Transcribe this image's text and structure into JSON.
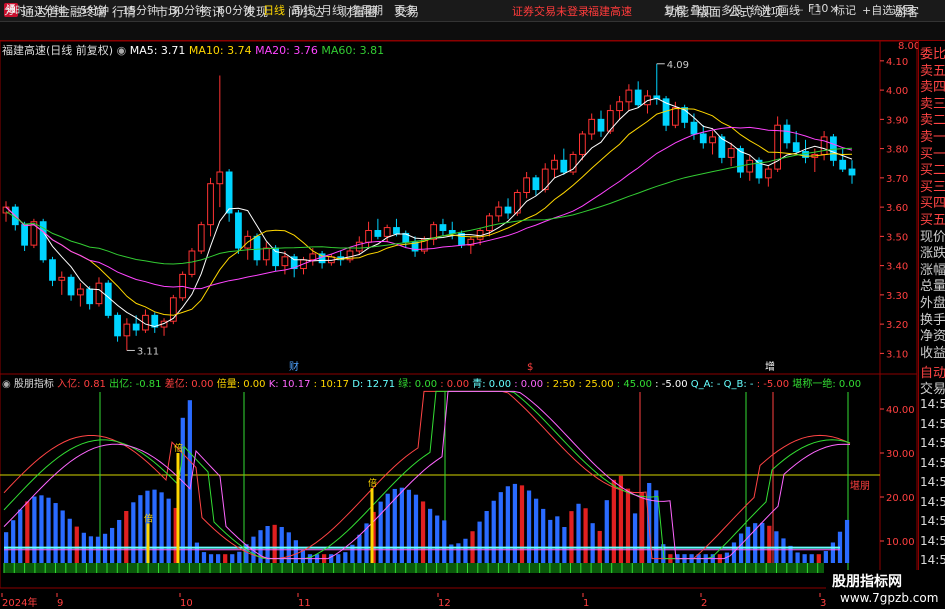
{
  "app": {
    "title": "通达信金融终端",
    "logo": "通"
  },
  "menu": [
    "行情",
    "市场",
    "资讯",
    "发现",
    "问小达",
    "财富圈",
    "交易"
  ],
  "alerts": {
    "login": "证券交易未登录",
    "stock": "福建高速"
  },
  "right_menu": [
    "功能",
    "版面",
    "公式",
    "选项"
  ],
  "guest": "游客",
  "window_buttons": [
    "minimize-icon",
    "restore-icon",
    "close-icon"
  ],
  "periods": [
    "分时",
    "1分钟",
    "5分钟",
    "15分钟",
    "30分钟",
    "60分钟",
    "日线",
    "周线",
    "月线",
    "多周期",
    "更多"
  ],
  "active_period": "日线",
  "toolbar_right": [
    "复权",
    "叠加",
    "多股",
    "统计",
    "画线",
    "F10",
    "标记",
    "+自选",
    "返回"
  ],
  "chart_info": {
    "stock": "福建高速",
    "adjust": "(日线 前复权)",
    "ma5": "MA5: 3.71",
    "ma10": "MA10: 3.74",
    "ma20": "MA20: 3.76",
    "ma60": "MA60: 3.81",
    "high_marker": "4.09",
    "low_marker": "3.11",
    "events": [
      "财",
      "$",
      "增"
    ]
  },
  "price_axis": [
    "4.10",
    "4.00",
    "3.90",
    "3.80",
    "3.70",
    "3.60",
    "3.50",
    "3.40",
    "3.30",
    "3.20",
    "3.10"
  ],
  "price_corner": "8.00",
  "indicator": {
    "name": "股朋指标",
    "items": [
      {
        "label": "入亿: 0.81",
        "color": "#ff4040"
      },
      {
        "label": "出亿: -0.81",
        "color": "#33dd33"
      },
      {
        "label": "差亿: 0.00",
        "color": "#ff4040"
      },
      {
        "label": "倍量: 0.00",
        "color": "#ffd700"
      },
      {
        "label": "K: 10.17",
        "color": "#ff66ff"
      },
      {
        "label": ": 10:17",
        "color": "#ffd700"
      },
      {
        "label": "D: 12.71",
        "color": "#66ffff"
      },
      {
        "label": "绿: 0.00",
        "color": "#33dd33"
      },
      {
        "label": ": 0.00",
        "color": "#ff4040"
      },
      {
        "label": "青: 0.00",
        "color": "#66ffff"
      },
      {
        "label": ": 0.00",
        "color": "#ff66ff"
      },
      {
        "label": ": 2:50",
        "color": "#ffd700"
      },
      {
        "label": ": 25.00",
        "color": "#ffd700"
      },
      {
        "label": ": 45.00",
        "color": "#33dd33"
      },
      {
        "label": ": -5.00",
        "color": "#ffffff"
      },
      {
        "label": "Q_A: -",
        "color": "#66ffff"
      },
      {
        "label": "Q_B: -",
        "color": "#66ffff"
      },
      {
        "label": ": -5.00",
        "color": "#ff4040"
      },
      {
        "label": "堪称一绝: 0.00",
        "color": "#33dd33"
      }
    ],
    "axis": [
      "40.00",
      "30.00",
      "20.00",
      "10.00"
    ],
    "label_in_chart": "堪朋",
    "bei_marks": [
      "倍",
      "倍",
      "倍"
    ]
  },
  "date_axis": [
    "2024年",
    "9",
    "10",
    "11",
    "12",
    "1",
    "2",
    "3"
  ],
  "right_panel": {
    "labels": [
      {
        "t": "委比",
        "c": "red"
      },
      {
        "t": "卖五",
        "c": "red"
      },
      {
        "t": "卖四",
        "c": "red"
      },
      {
        "t": "卖三",
        "c": "red"
      },
      {
        "t": "卖二",
        "c": "red"
      },
      {
        "t": "卖一",
        "c": "red"
      },
      {
        "t": "买一",
        "c": "red"
      },
      {
        "t": "买二",
        "c": "red"
      },
      {
        "t": "买三",
        "c": "red"
      },
      {
        "t": "买四",
        "c": "red"
      },
      {
        "t": "买五",
        "c": "red"
      },
      {
        "t": "现价",
        "c": ""
      },
      {
        "t": "涨跌",
        "c": ""
      },
      {
        "t": "涨幅",
        "c": ""
      },
      {
        "t": "总量",
        "c": ""
      },
      {
        "t": "外盘",
        "c": ""
      },
      {
        "t": "换手",
        "c": ""
      },
      {
        "t": "净资",
        "c": ""
      },
      {
        "t": "收益",
        "c": ""
      },
      {
        "t": "自动",
        "c": "red"
      },
      {
        "t": "交易",
        "c": ""
      }
    ],
    "times": [
      "14:56",
      "14:56",
      "14:56",
      "14:56",
      "14:56",
      "14:56",
      "14:56",
      "14:56",
      "14:56"
    ]
  },
  "watermark": {
    "line1": "股朋指标网",
    "line2": "www.7gpzb.com"
  },
  "colors": {
    "up": "#ff3333",
    "down": "#00d4ff",
    "ma5": "#ffffff",
    "ma10": "#ffd700",
    "ma20": "#ff44ff",
    "ma60": "#33cc33",
    "grid": "#8b0000"
  },
  "chart_data": {
    "type": "candlestick",
    "series_note": "daily OHLC approximated from chart",
    "candles": [
      [
        3.58,
        3.62,
        3.55,
        3.6
      ],
      [
        3.6,
        3.61,
        3.52,
        3.54
      ],
      [
        3.54,
        3.55,
        3.45,
        3.47
      ],
      [
        3.47,
        3.56,
        3.46,
        3.55
      ],
      [
        3.55,
        3.56,
        3.41,
        3.42
      ],
      [
        3.42,
        3.43,
        3.33,
        3.35
      ],
      [
        3.35,
        3.38,
        3.3,
        3.36
      ],
      [
        3.36,
        3.37,
        3.28,
        3.3
      ],
      [
        3.3,
        3.34,
        3.26,
        3.32
      ],
      [
        3.32,
        3.33,
        3.25,
        3.27
      ],
      [
        3.27,
        3.36,
        3.26,
        3.34
      ],
      [
        3.34,
        3.35,
        3.22,
        3.23
      ],
      [
        3.23,
        3.24,
        3.14,
        3.16
      ],
      [
        3.16,
        3.22,
        3.11,
        3.2
      ],
      [
        3.2,
        3.23,
        3.16,
        3.18
      ],
      [
        3.18,
        3.25,
        3.17,
        3.23
      ],
      [
        3.23,
        3.24,
        3.17,
        3.19
      ],
      [
        3.19,
        3.22,
        3.16,
        3.21
      ],
      [
        3.21,
        3.3,
        3.2,
        3.29
      ],
      [
        3.29,
        3.38,
        3.28,
        3.37
      ],
      [
        3.37,
        3.46,
        3.36,
        3.45
      ],
      [
        3.45,
        3.55,
        3.44,
        3.54
      ],
      [
        3.54,
        3.7,
        3.5,
        3.68
      ],
      [
        3.68,
        4.05,
        3.6,
        3.72
      ],
      [
        3.72,
        3.73,
        3.55,
        3.58
      ],
      [
        3.58,
        3.59,
        3.44,
        3.46
      ],
      [
        3.46,
        3.52,
        3.42,
        3.5
      ],
      [
        3.5,
        3.51,
        3.4,
        3.42
      ],
      [
        3.42,
        3.48,
        3.4,
        3.46
      ],
      [
        3.46,
        3.47,
        3.38,
        3.4
      ],
      [
        3.4,
        3.45,
        3.37,
        3.43
      ],
      [
        3.43,
        3.44,
        3.36,
        3.39
      ],
      [
        3.39,
        3.43,
        3.37,
        3.42
      ],
      [
        3.42,
        3.46,
        3.4,
        3.44
      ],
      [
        3.44,
        3.45,
        3.39,
        3.41
      ],
      [
        3.41,
        3.44,
        3.4,
        3.43
      ],
      [
        3.43,
        3.45,
        3.4,
        3.42
      ],
      [
        3.42,
        3.46,
        3.41,
        3.45
      ],
      [
        3.45,
        3.5,
        3.44,
        3.48
      ],
      [
        3.48,
        3.55,
        3.46,
        3.52
      ],
      [
        3.52,
        3.56,
        3.49,
        3.5
      ],
      [
        3.5,
        3.54,
        3.48,
        3.53
      ],
      [
        3.53,
        3.56,
        3.5,
        3.51
      ],
      [
        3.51,
        3.52,
        3.46,
        3.48
      ],
      [
        3.48,
        3.5,
        3.43,
        3.45
      ],
      [
        3.45,
        3.5,
        3.44,
        3.49
      ],
      [
        3.49,
        3.55,
        3.47,
        3.54
      ],
      [
        3.54,
        3.56,
        3.5,
        3.52
      ],
      [
        3.52,
        3.55,
        3.49,
        3.51
      ],
      [
        3.51,
        3.52,
        3.46,
        3.47
      ],
      [
        3.47,
        3.5,
        3.44,
        3.49
      ],
      [
        3.49,
        3.53,
        3.47,
        3.52
      ],
      [
        3.52,
        3.58,
        3.5,
        3.57
      ],
      [
        3.57,
        3.62,
        3.55,
        3.6
      ],
      [
        3.6,
        3.63,
        3.56,
        3.58
      ],
      [
        3.58,
        3.66,
        3.57,
        3.65
      ],
      [
        3.65,
        3.72,
        3.63,
        3.7
      ],
      [
        3.7,
        3.71,
        3.64,
        3.66
      ],
      [
        3.66,
        3.75,
        3.65,
        3.73
      ],
      [
        3.73,
        3.78,
        3.7,
        3.76
      ],
      [
        3.76,
        3.8,
        3.71,
        3.72
      ],
      [
        3.72,
        3.79,
        3.71,
        3.78
      ],
      [
        3.78,
        3.86,
        3.76,
        3.85
      ],
      [
        3.85,
        3.92,
        3.83,
        3.9
      ],
      [
        3.9,
        3.93,
        3.84,
        3.86
      ],
      [
        3.86,
        3.95,
        3.85,
        3.93
      ],
      [
        3.93,
        3.98,
        3.9,
        3.96
      ],
      [
        3.96,
        4.02,
        3.93,
        4.0
      ],
      [
        4.0,
        4.03,
        3.94,
        3.95
      ],
      [
        3.95,
        4.0,
        3.92,
        3.98
      ],
      [
        3.98,
        4.09,
        3.95,
        3.97
      ],
      [
        3.97,
        3.98,
        3.86,
        3.88
      ],
      [
        3.88,
        3.96,
        3.87,
        3.94
      ],
      [
        3.94,
        3.95,
        3.87,
        3.89
      ],
      [
        3.89,
        3.92,
        3.83,
        3.85
      ],
      [
        3.85,
        3.88,
        3.8,
        3.82
      ],
      [
        3.82,
        3.86,
        3.78,
        3.84
      ],
      [
        3.84,
        3.85,
        3.75,
        3.77
      ],
      [
        3.77,
        3.82,
        3.74,
        3.8
      ],
      [
        3.8,
        3.81,
        3.7,
        3.72
      ],
      [
        3.72,
        3.78,
        3.69,
        3.76
      ],
      [
        3.76,
        3.77,
        3.68,
        3.7
      ],
      [
        3.7,
        3.74,
        3.67,
        3.73
      ],
      [
        3.73,
        3.91,
        3.72,
        3.88
      ],
      [
        3.88,
        3.9,
        3.8,
        3.82
      ],
      [
        3.82,
        3.86,
        3.78,
        3.79
      ],
      [
        3.79,
        3.83,
        3.75,
        3.77
      ],
      [
        3.77,
        3.8,
        3.72,
        3.78
      ],
      [
        3.78,
        3.86,
        3.76,
        3.84
      ],
      [
        3.84,
        3.85,
        3.74,
        3.76
      ],
      [
        3.76,
        3.8,
        3.72,
        3.73
      ],
      [
        3.73,
        3.76,
        3.68,
        3.71
      ]
    ],
    "ma_levels": {
      "ma5": 3.71,
      "ma10": 3.74,
      "ma20": 3.76,
      "ma60": 3.81
    },
    "ylim": [
      3.05,
      4.12
    ]
  }
}
